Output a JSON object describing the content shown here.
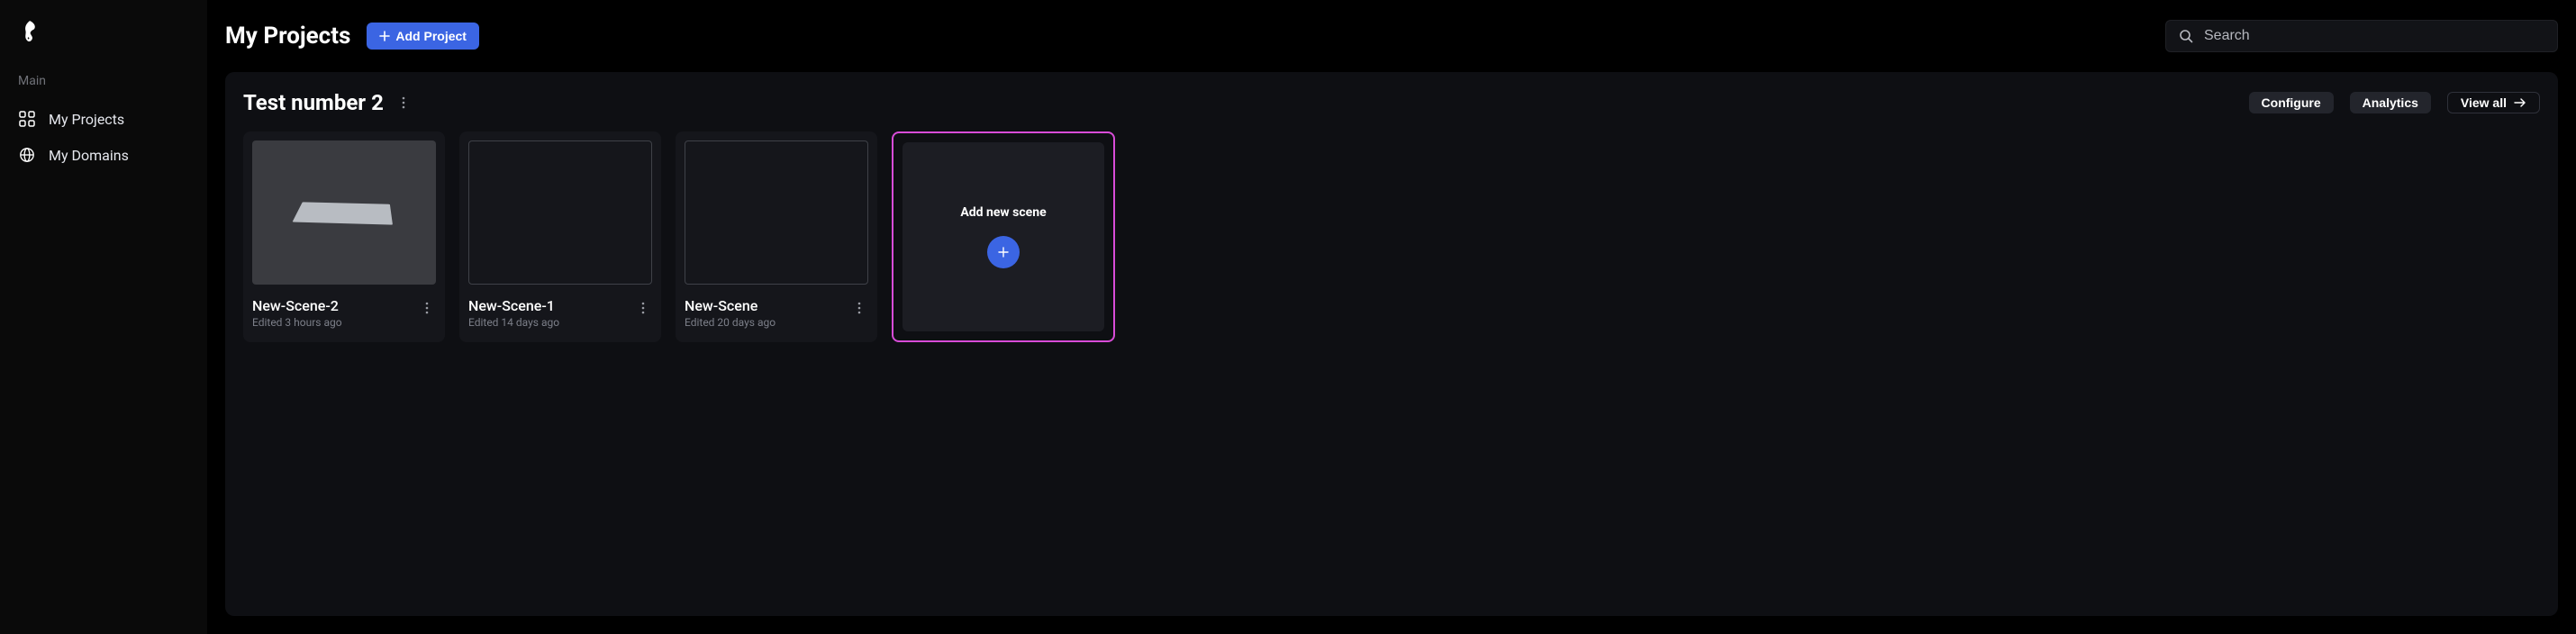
{
  "sidebar": {
    "section_label": "Main",
    "items": [
      {
        "label": "My Projects"
      },
      {
        "label": "My Domains"
      }
    ]
  },
  "header": {
    "title": "My Projects",
    "add_button": "Add Project",
    "search_placeholder": "Search"
  },
  "panel": {
    "title": "Test number 2",
    "configure_label": "Configure",
    "analytics_label": "Analytics",
    "view_all_label": "View all",
    "scenes": [
      {
        "name": "New-Scene-2",
        "edited": "Edited 3 hours ago"
      },
      {
        "name": "New-Scene-1",
        "edited": "Edited 14 days ago"
      },
      {
        "name": "New-Scene",
        "edited": "Edited 20 days ago"
      }
    ],
    "add_card_label": "Add new scene"
  },
  "colors": {
    "accent": "#3b65e3",
    "highlight_border": "#d84cd8"
  }
}
